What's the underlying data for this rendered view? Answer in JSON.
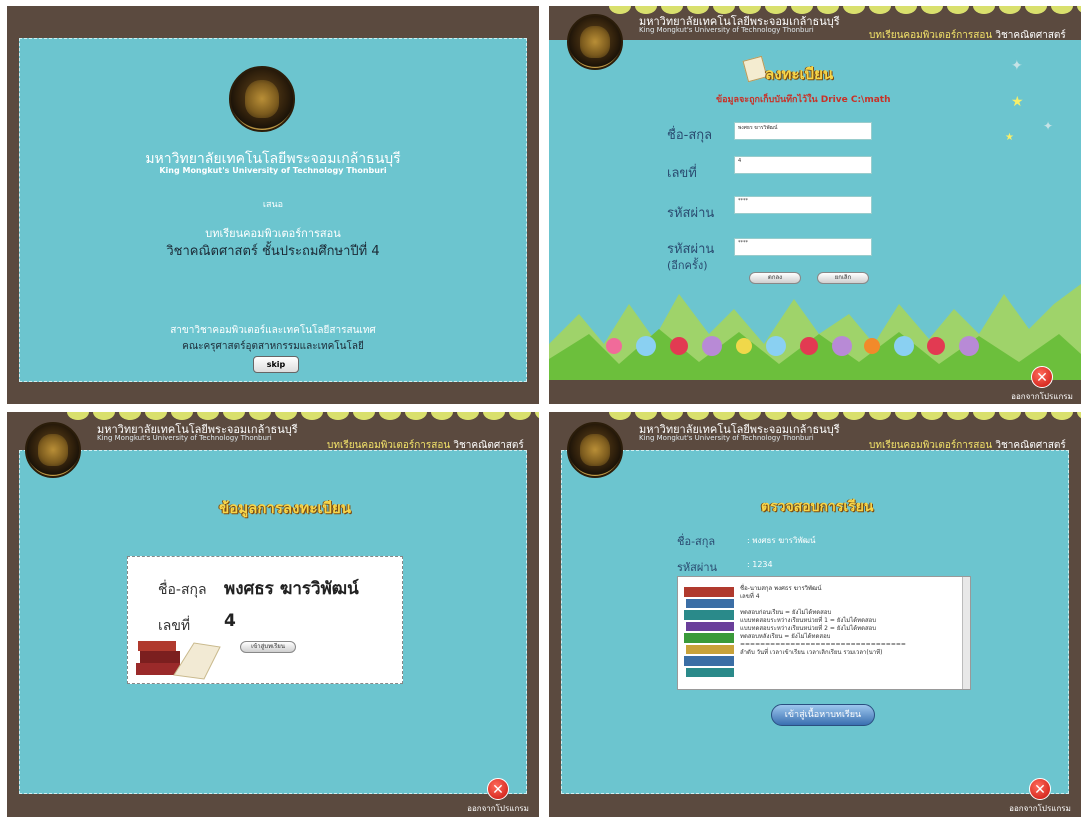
{
  "common": {
    "uni_th": "มหาวิทยาลัยเทคโนโลยีพระจอมเกล้าธนบุรี",
    "uni_en": "King Mongkut's University of Technology Thonburi",
    "header_cai": "บทเรียนคอมพิวเตอร์การสอน",
    "header_subject": "วิชาคณิตศาสตร์",
    "exit_label": "ออกจากโปรแกรม"
  },
  "intro": {
    "uni_th": "มหาวิทยาลัยเทคโนโลยีพระจอมเกล้าธนบุรี",
    "uni_en": "King Mongkut's University of Technology Thonburi",
    "present": "เสนอ",
    "cai": "บทเรียนคอมพิวเตอร์การสอน",
    "subject": "วิชาคณิตศาสตร์ ชั้นประถมศึกษาปีที่ 4",
    "dept": "สาขาวิชาคอมพิวเตอร์และเทคโนโลยีสารสนเทศ",
    "faculty": "คณะครุศาสตร์อุตสาหกรรมและเทคโนโลยี",
    "skip": "skip"
  },
  "register": {
    "title": "ลงทะเบียน",
    "notice": "ข้อมูลจะถูกเก็บบันทึกไว้ใน Drive C:\\math",
    "name_label": "ชื่อ-สกุล",
    "name_value": "พงศธร ฆารวิพัฒน์",
    "number_label": "เลขที่",
    "number_value": "4",
    "password_label": "รหัสผ่าน",
    "password_value": "****",
    "password2_label": "รหัสผ่าน",
    "password2_sub": "(อีกครั้ง)",
    "password2_value": "****",
    "ok": "ตกลง",
    "cancel": "ยกเลิก"
  },
  "reginfo": {
    "title": "ข้อมูลการลงทะเบียน",
    "name_label": "ชื่อ-สกุล",
    "name_value": "พงศธร ฆารวิพัฒน์",
    "number_label": "เลขที่",
    "number_value": "4",
    "enter": "เข้าสู่บทเรียน"
  },
  "check": {
    "title": "ตรวจสอบการเรียน",
    "name_label": "ชื่อ-สกุล",
    "name_value": ": พงศธร ฆารวิพัฒน์",
    "password_label": "รหัสผ่าน",
    "password_value": ": 1234",
    "log_lines": [
      "ชื่อ-นามสกุล พงศธร ฆารวิพัฒน์",
      "เลขที่ 4",
      "",
      "ทดสอบก่อนเรียน = ยังไม่ได้ทดสอบ",
      "แบบทดสอบระหว่างเรียนหน่วยที่ 1 = ยังไม่ได้ทดสอบ",
      "แบบทดสอบระหว่างเรียนหน่วยที่ 2 = ยังไม่ได้ทดสอบ",
      "ทดสอบหลังเรียน = ยังไม่ได้ทดสอบ",
      "=================================",
      "ลำดับ วันที่  เวลาเข้าเรียน เวลาเลิกเรียน รวมเวลา(นาที)"
    ],
    "enter_button": "เข้าสู่เนื้อหาบทเรียน"
  }
}
